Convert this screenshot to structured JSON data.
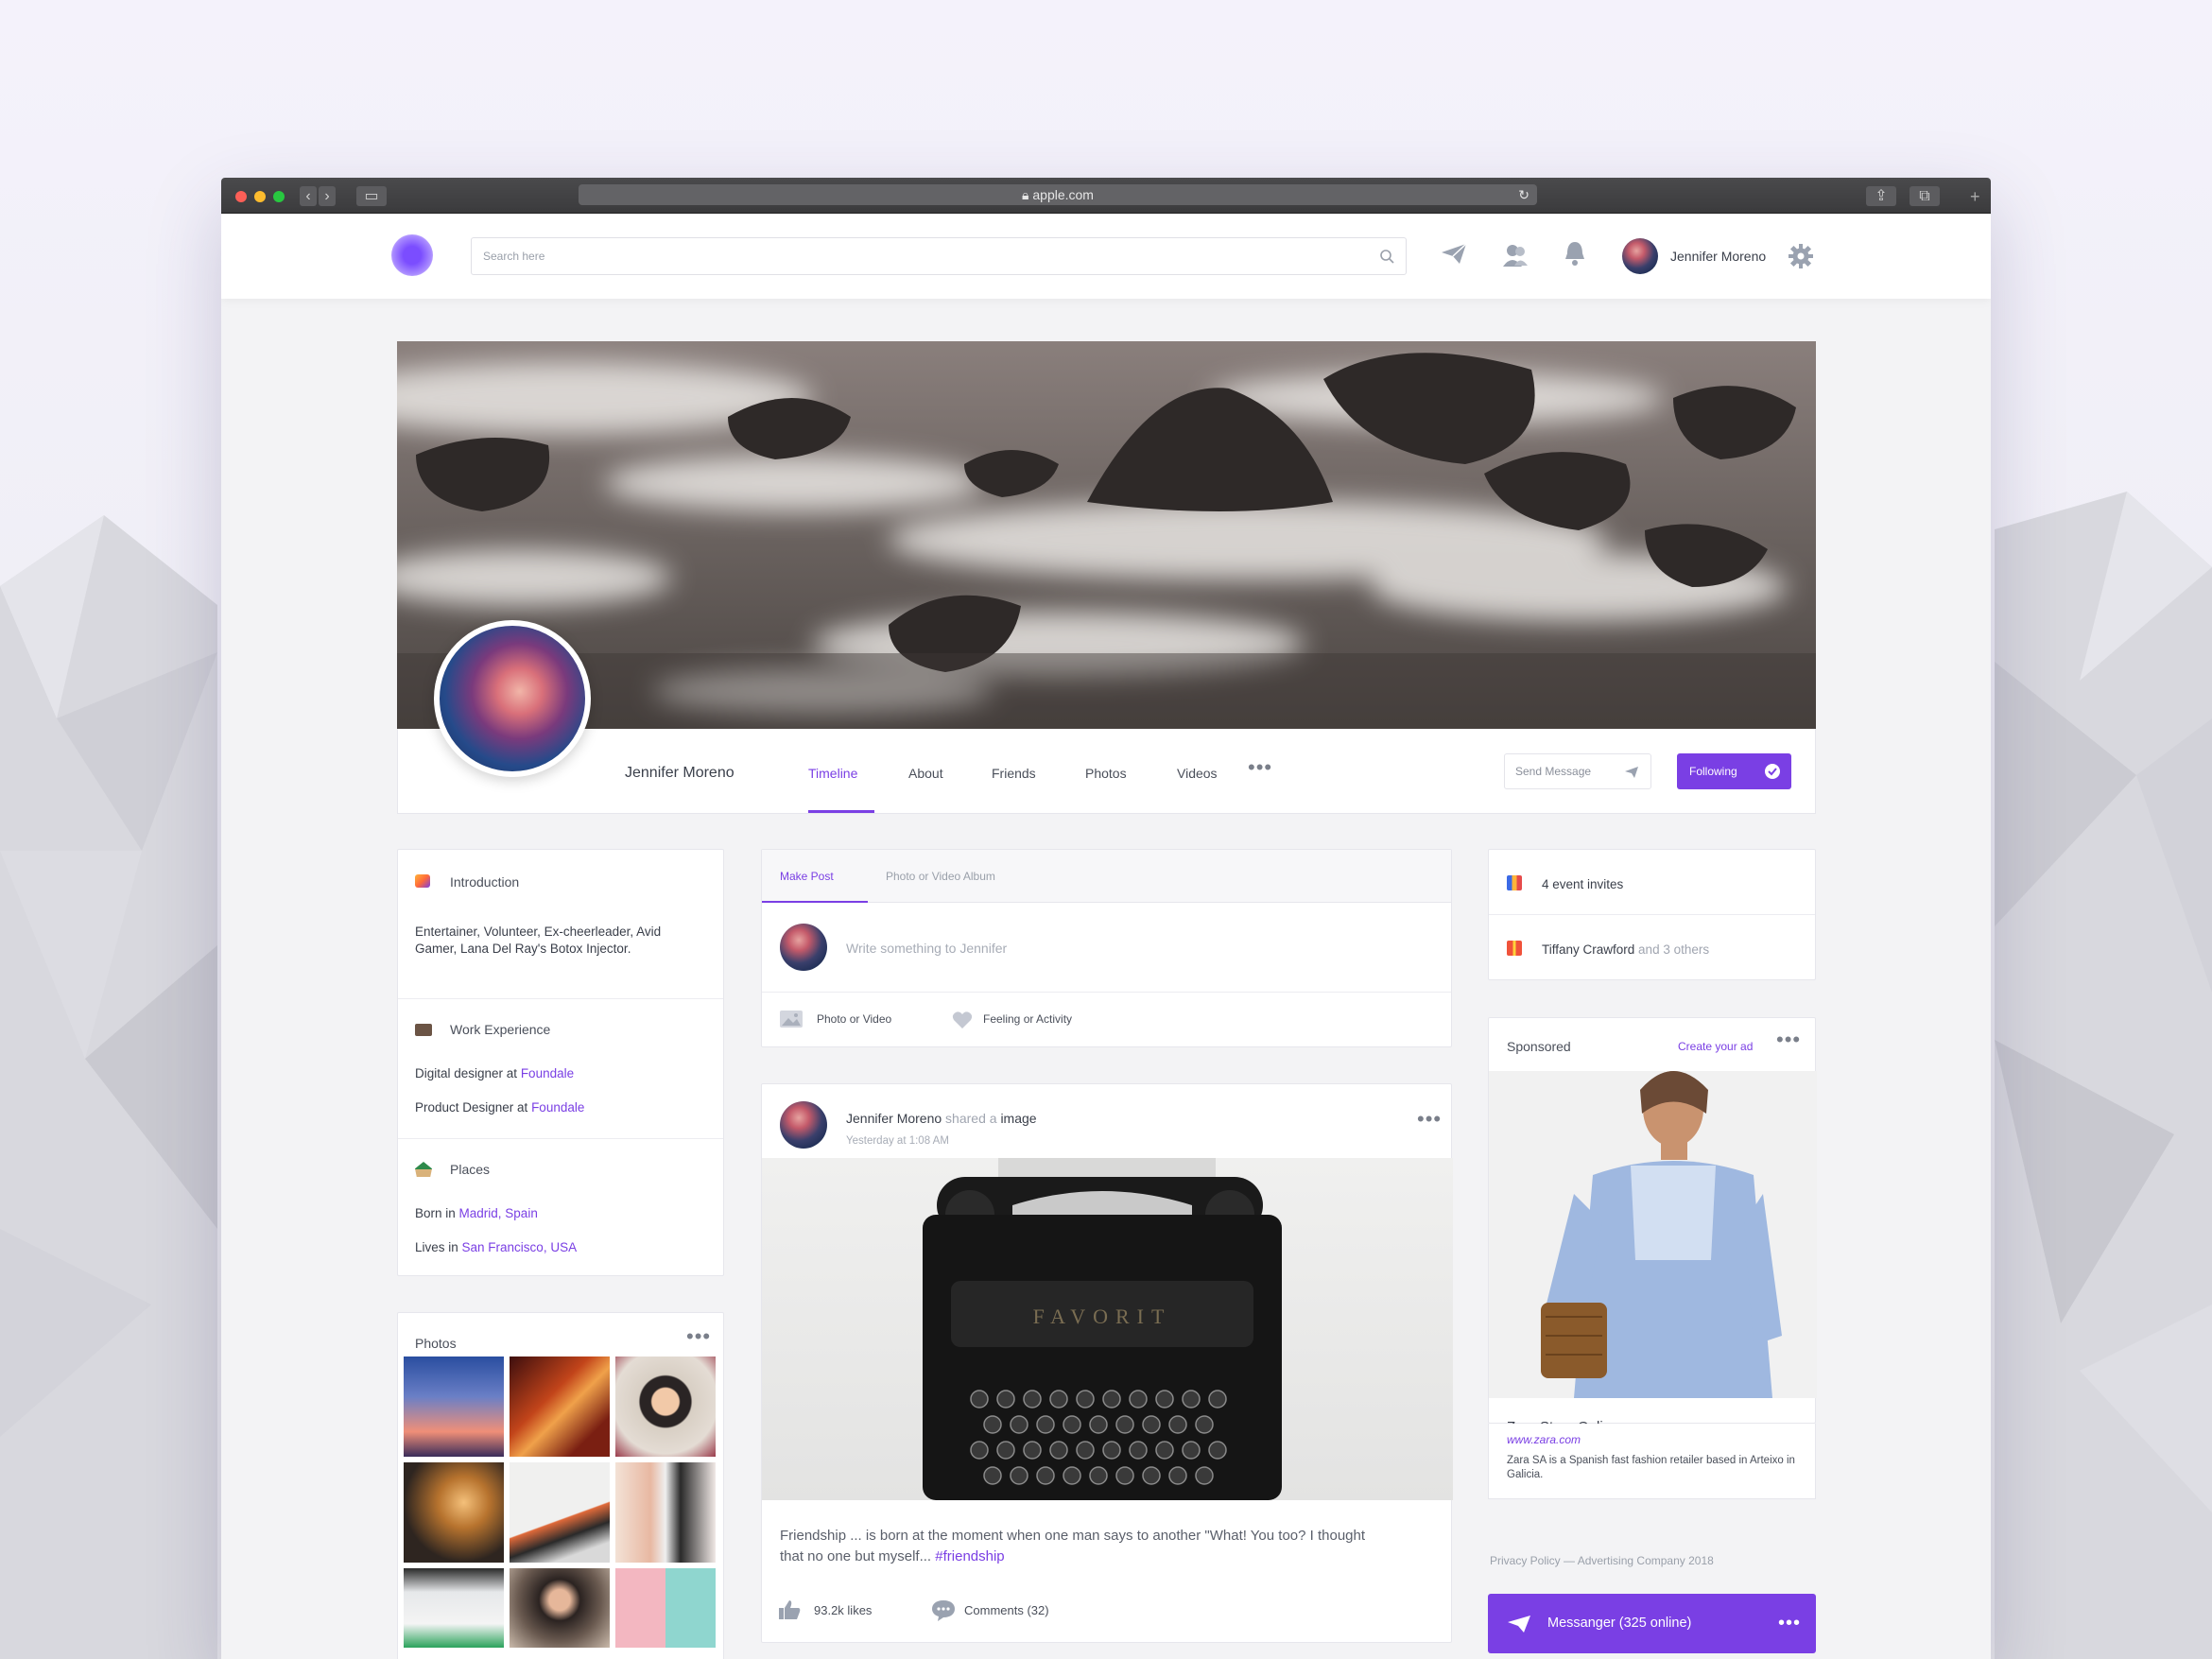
{
  "browser": {
    "url": "apple.com"
  },
  "header": {
    "search_placeholder": "Search here",
    "user_name": "Jennifer Moreno"
  },
  "profile": {
    "name": "Jennifer Moreno",
    "tabs": [
      "Timeline",
      "About",
      "Friends",
      "Photos",
      "Videos"
    ],
    "send_message": "Send Message",
    "following": "Following"
  },
  "intro": {
    "title": "Introduction",
    "text": "Entertainer, Volunteer, Ex-cheerleader, Avid Gamer, Lana Del Ray's Botox Injector.",
    "work_title": "Work Experience",
    "work": [
      {
        "role": "Digital designer at ",
        "company": "Foundale"
      },
      {
        "role": "Product Designer at ",
        "company": "Foundale"
      }
    ],
    "places_title": "Places",
    "places": [
      {
        "prefix": "Born in ",
        "place": "Madrid, Spain"
      },
      {
        "prefix": "Lives in ",
        "place": "San Francisco, USA"
      }
    ]
  },
  "photos": {
    "title": "Photos"
  },
  "composer": {
    "tabs": [
      "Make Post",
      "Photo or Video Album"
    ],
    "placeholder": "Write something to Jennifer",
    "actions": [
      "Photo or Video",
      "Feeling or Activity"
    ]
  },
  "post": {
    "author": "Jennifer Moreno",
    "shared": " shared a ",
    "object": "image",
    "time": "Yesterday at 1:08 AM",
    "text": "Friendship ... is born at the moment when one man says to another \"What! You too? I thought that no one but myself...",
    "tag": "#friendship",
    "likes": "93.2k likes",
    "comments": "Comments (32)",
    "typewriter_brand": "FAVORIT"
  },
  "events": {
    "invites": "4 event invites",
    "birthday_name": "Tiffany Crawford",
    "birthday_rest": " and 3 others"
  },
  "sponsored": {
    "title": "Sponsored",
    "create": "Create your ad",
    "store": "Zara Store Online",
    "url": "www.zara.com",
    "desc": "Zara SA is a Spanish fast fashion retailer based in Arteixo in Galicia."
  },
  "footer": {
    "privacy": "Privacy Policy",
    "sep": "—",
    "company": "Advertising Company 2018"
  },
  "messenger": {
    "label": "Messanger (325 online)"
  },
  "colors": {
    "accent": "#7a3fe4",
    "background": "#f4f2fb"
  }
}
